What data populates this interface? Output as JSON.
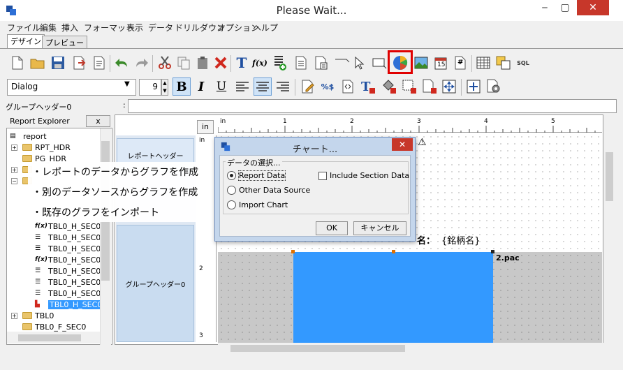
{
  "window": {
    "title": "Please Wait...",
    "close_glyph": "✕",
    "min_glyph": "‒",
    "max_glyph": "▢"
  },
  "menu": [
    "ファイル",
    "編集",
    "挿入",
    "フォーマット",
    "表示",
    "データ",
    "ドリルダウン",
    "オプション",
    "ヘルプ"
  ],
  "tabs": {
    "design": "デザイン",
    "preview": "プレビュー"
  },
  "toolbar": {
    "font_name": "Dialog",
    "font_size": "9",
    "bold": "B",
    "italic": "I",
    "underline": "U",
    "text_tool": "T",
    "formula_tool": "f(x)",
    "date_label": "15",
    "page_label": "#",
    "sql_label": "SQL",
    "percent_label": "%$",
    "highlight_color": "#e00000"
  },
  "property_bar": {
    "label": "グループヘッダー0",
    "colon": ":",
    "value": ""
  },
  "explorer": {
    "title": "Report Explorer",
    "close_label": "x",
    "items": [
      {
        "label": "report",
        "kind": "report"
      },
      {
        "label": "RPT_HDR",
        "kind": "folder"
      },
      {
        "label": "PG_HDR",
        "kind": "folder"
      },
      {
        "label": "",
        "kind": "folder"
      },
      {
        "label": "",
        "kind": "folder"
      },
      {
        "label": "TBL0_H_SEC0",
        "kind": "formula"
      },
      {
        "label": "TBL0_H_SEC0",
        "kind": "field"
      },
      {
        "label": "TBL0_H_SEC0",
        "kind": "field"
      },
      {
        "label": "TBL0_H_SEC0",
        "kind": "formula"
      },
      {
        "label": "TBL0_H_SEC0",
        "kind": "field"
      },
      {
        "label": "TBL0_H_SEC0",
        "kind": "field"
      },
      {
        "label": "TBL0_H_SEC0",
        "kind": "field"
      },
      {
        "label": "TBL0_H_SEC0",
        "kind": "chart",
        "selected": true
      },
      {
        "label": "TBL0",
        "kind": "folder"
      },
      {
        "label": "TBL0_F_SEC0",
        "kind": "folder"
      }
    ]
  },
  "sections": {
    "report_header": "レポートヘッダー",
    "group_header": "グループヘッダー0"
  },
  "ruler": {
    "unit": "in",
    "h_numbers": [
      "1",
      "2",
      "3",
      "4",
      "5"
    ],
    "v_numbers": [
      "2",
      "3"
    ]
  },
  "canvas": {
    "field_label": "名：",
    "field_value": "{銘柄名}",
    "chart_label": "2.pac",
    "warning_glyph": "⚠"
  },
  "callout": {
    "lines": [
      "・レポートのデータからグラフを作成",
      "・別のデータソースからグラフを作成",
      "・既存のグラフをインポート"
    ]
  },
  "dialog": {
    "title": "チャート...",
    "close_glyph": "✕",
    "group_title": "データの選択...",
    "options": [
      {
        "label": "Report Data",
        "selected": true
      },
      {
        "label": "Other Data Source",
        "selected": false
      },
      {
        "label": "Import Chart",
        "selected": false
      }
    ],
    "include_section_label": "Include Section Data",
    "include_section_checked": false,
    "ok_label": "OK",
    "cancel_label": "キャンセル"
  }
}
